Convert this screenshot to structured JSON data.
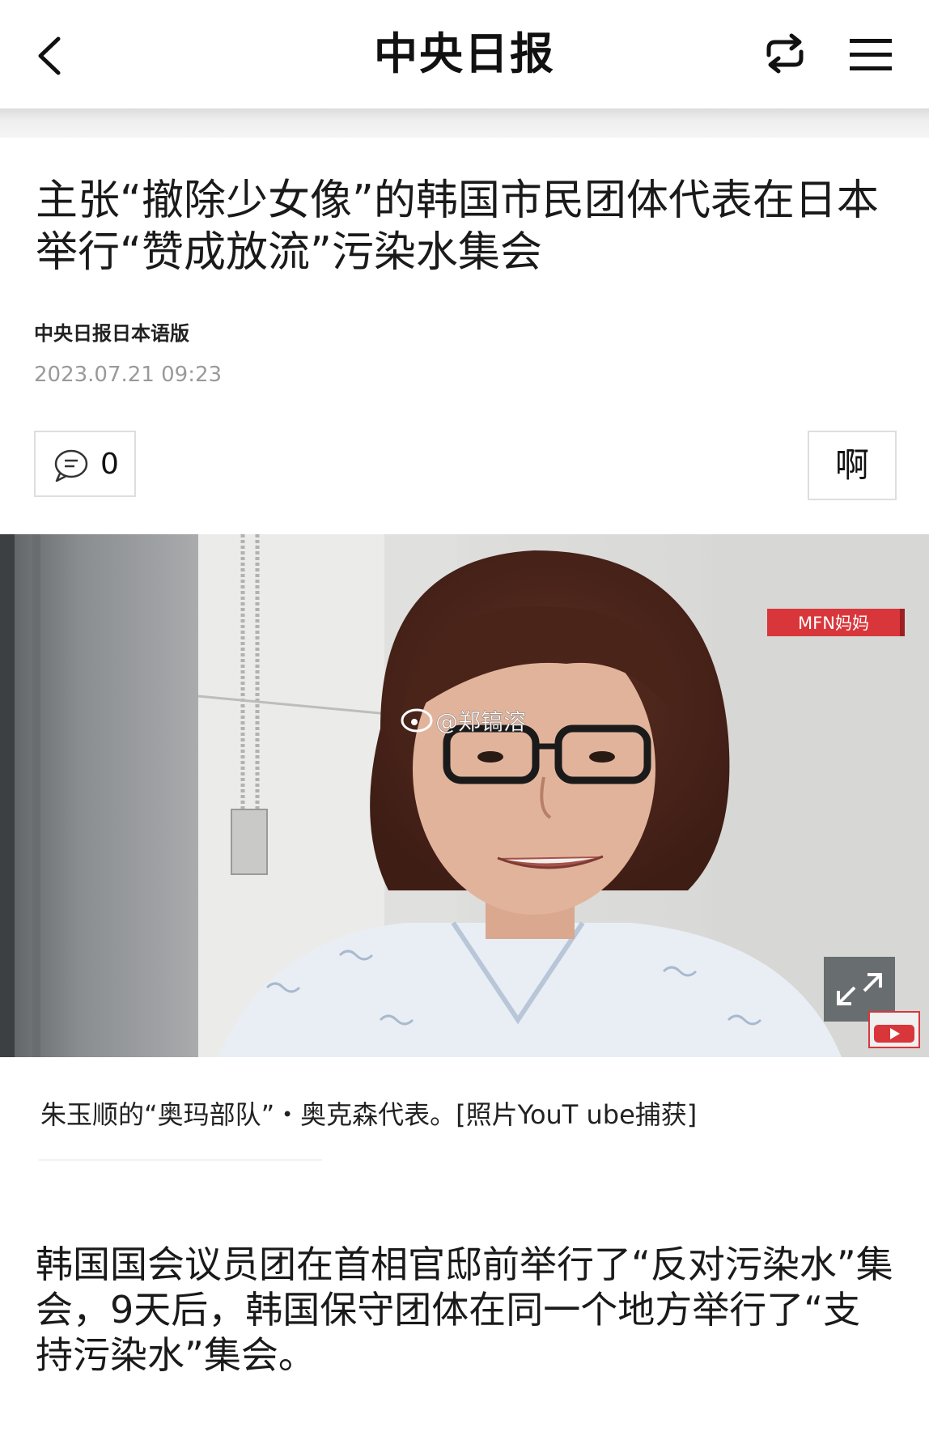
{
  "header": {
    "title": "中央日报",
    "back_icon": "back-chevron-icon",
    "share_icon": "share-refresh-icon",
    "menu_icon": "hamburger-menu-icon"
  },
  "article": {
    "headline": " 主张“撤除少女像”的韩国市民团体代表在日本举行“赞成放流”污染水集会",
    "source": "中央日报日本语版",
    "date": "2023.07.21 09:23",
    "comment_count": "0",
    "font_button_label": "啊",
    "photo": {
      "badge": "MFN妈妈",
      "watermark": "@郑镐溶",
      "corner_logo": "YouTube"
    },
    "caption": "朱玉顺的“奥玛部队”・奥克森代表。[照片YouT ube捕获]",
    "body": "韩国国会议员团在首相官邸前举行了“反对污染水”集会，9天后，韩国保守团体在同一个地方举行了“支持污染水”集会。"
  },
  "colors": {
    "badge_red": "#d9363b",
    "date_grey": "#9a9a9a",
    "border_grey": "#dedede"
  }
}
